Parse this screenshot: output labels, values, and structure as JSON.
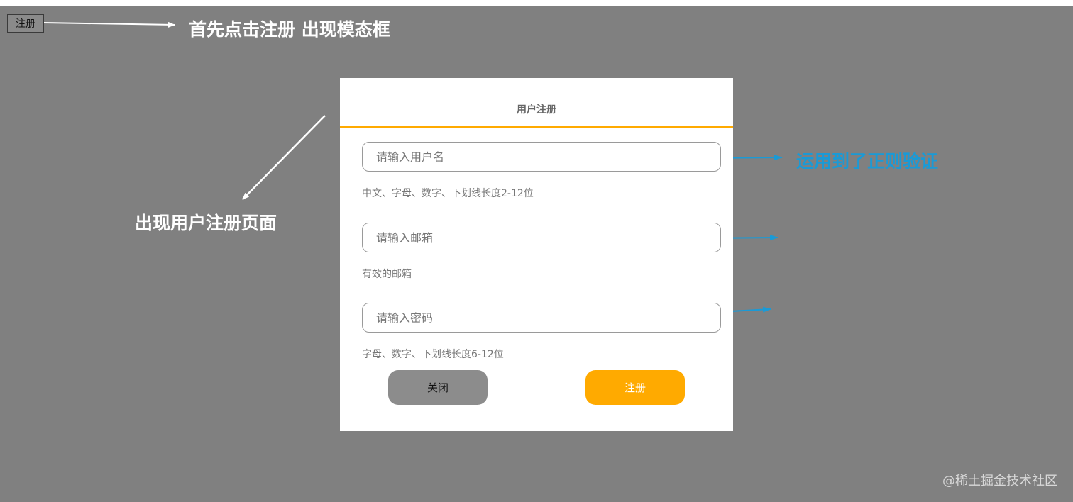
{
  "page": {
    "open_button_label": "注册"
  },
  "annotations": {
    "top": "首先点击注册 出现模态框",
    "left": "出现用户注册页面",
    "right": "运用到了正则验证"
  },
  "modal": {
    "title": "用户注册",
    "username": {
      "value": "",
      "placeholder": "请输入用户名",
      "hint": "中文、字母、数字、下划线长度2-12位"
    },
    "email": {
      "value": "",
      "placeholder": "请输入邮箱",
      "hint": "有效的邮箱"
    },
    "password": {
      "value": "",
      "placeholder": "请输入密码",
      "hint": "字母、数字、下划线长度6-12位"
    },
    "close_label": "关闭",
    "register_label": "注册"
  },
  "watermark": "@稀土掘金技术社区",
  "colors": {
    "overlay": "#808080",
    "accent": "#ffaa00",
    "annotation_blue": "#1a9ad6",
    "annotation_white": "#ffffff"
  }
}
